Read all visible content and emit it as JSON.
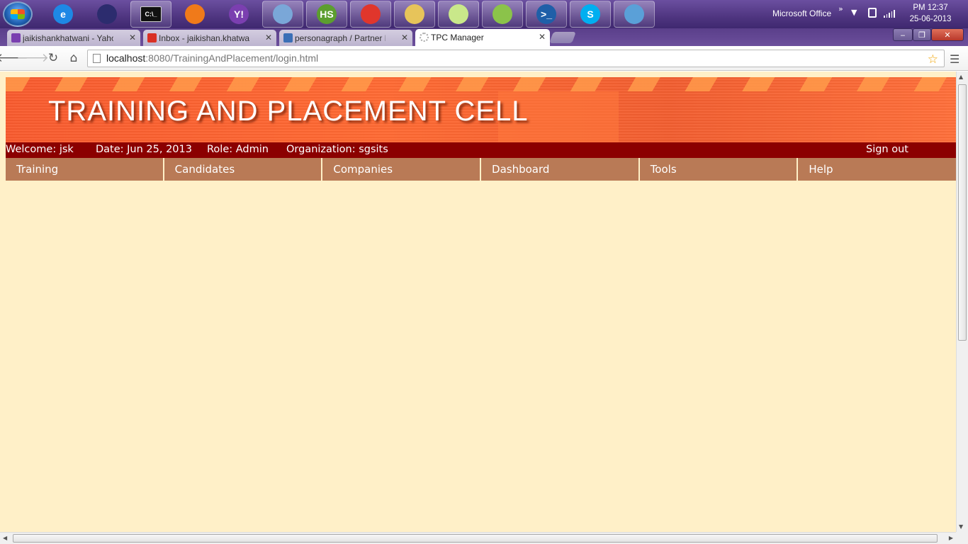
{
  "taskbar": {
    "apps": [
      {
        "name": "ie-icon",
        "label": "e",
        "color": "#1e88e5"
      },
      {
        "name": "eclipse-icon",
        "label": "",
        "color": "#2c2c6e"
      },
      {
        "name": "cmd-icon",
        "label": "C:\\_",
        "color": "#111111"
      },
      {
        "name": "media-player-icon",
        "label": "",
        "color": "#f07a1a"
      },
      {
        "name": "yahoo-messenger-icon",
        "label": "Y!",
        "color": "#7b3fb0"
      },
      {
        "name": "virtualbox-icon",
        "label": "",
        "color": "#7aa7d8"
      },
      {
        "name": "hotspot-shield-icon",
        "label": "HS",
        "color": "#5c9e2f"
      },
      {
        "name": "chrome-icon",
        "label": "",
        "color": "#e0362c"
      },
      {
        "name": "file-explorer-icon",
        "label": "",
        "color": "#e7c45a"
      },
      {
        "name": "sticky-notes-icon",
        "label": "",
        "color": "#c9e88a"
      },
      {
        "name": "notepadpp-icon",
        "label": "",
        "color": "#8bc34a"
      },
      {
        "name": "powershell-icon",
        "label": ">_",
        "color": "#1f5fa8"
      },
      {
        "name": "skype-icon",
        "label": "S",
        "color": "#00aff0"
      },
      {
        "name": "paint-icon",
        "label": "",
        "color": "#5aa0d8"
      }
    ],
    "tray_text": "Microsoft Office",
    "tray_chevron": "»",
    "clock_time": "PM 12:37",
    "clock_date": "25-06-2013"
  },
  "browser": {
    "tabs": [
      {
        "title": "jaikishankhatwani - Yahoo",
        "icon_color": "#7a3fb0",
        "active": false
      },
      {
        "title": "Inbox - jaikishan.khatwani",
        "icon_color": "#d93025",
        "active": false
      },
      {
        "title": "personagraph / Partner Pl",
        "icon_color": "#3b6fb6",
        "active": false
      },
      {
        "title": "TPC Manager",
        "icon_color": "#aaaaaa",
        "active": true
      }
    ],
    "url_host": "localhost",
    "url_path": ":8080/TrainingAndPlacement/login.html"
  },
  "page": {
    "banner_title": "TRAINING AND PLACEMENT CELL",
    "welcome": "Welcome: jsk",
    "date": "Date: Jun 25, 2013",
    "role": "Role: Admin",
    "organization": "Organization: sgsits",
    "sign_out": "Sign out",
    "nav": [
      "Training",
      "Candidates",
      "Companies",
      "Dashboard",
      "Tools",
      "Help"
    ]
  },
  "colors": {
    "banner_orange": "#f95b2e",
    "infobar": "#8b0000",
    "nav_item": "#b97a56",
    "page_bg": "#fff0c8"
  }
}
